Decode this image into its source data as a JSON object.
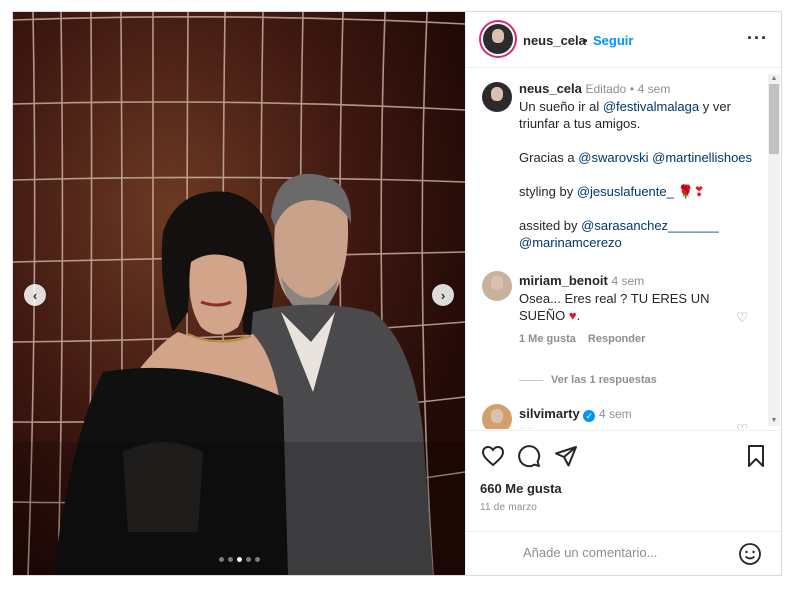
{
  "post": {
    "media": {
      "slide_count": 5,
      "active_slide_index": 2
    },
    "header": {
      "username": "neus_cela",
      "separator": "•",
      "follow_label": "Seguir",
      "more_icon": "more-horizontal-icon"
    },
    "caption": {
      "username": "neus_cela",
      "edited_label": "Editado",
      "separator": "•",
      "time": "4 sem",
      "line1_text": "Un sueño ir al ",
      "line1_mention": "@festivalmalaga",
      "line1_tail": " y ver",
      "line2_text": "triunfar a tus amigos.",
      "thanks_text": "Gracias a ",
      "thanks_mention1": "@swarovski",
      "thanks_mention2": "@martinellishoes",
      "styling_text": "styling by ",
      "styling_mention": "@jesuslafuente_",
      "styling_emoji": "🌹❣",
      "assisted_text": "assited by ",
      "assisted_mention1": "@sarasanchez_______",
      "assisted_mention2": "@marinamcerezo"
    },
    "comments": [
      {
        "username": "miriam_benoit",
        "time": "4 sem",
        "text_line1": "Osea... Eres real ? TU ERES UN",
        "text_line2": "SUEÑO ",
        "emoji": "♥",
        "text_tail": ".",
        "likes_label": "1 Me gusta",
        "reply_label": "Responder",
        "view_replies_label": "Ver las 1 respuestas"
      },
      {
        "username": "silvimarty",
        "verified": true,
        "time": "4 sem",
        "text": "♥♥"
      }
    ],
    "actions": {
      "like_icon": "heart-icon",
      "comment_icon": "comment-icon",
      "share_icon": "send-icon",
      "save_icon": "bookmark-icon"
    },
    "likes_label": "660 Me gusta",
    "date": "11 de marzo",
    "add_comment": {
      "placeholder": "Añade un comentario...",
      "emoji_icon": "smiley-icon"
    }
  },
  "colors": {
    "link_blue": "#0095f6",
    "mention": "#00376b",
    "verified": "#0095f6",
    "emoji_red": "#e0182d",
    "muted": "#8e8e8e"
  }
}
